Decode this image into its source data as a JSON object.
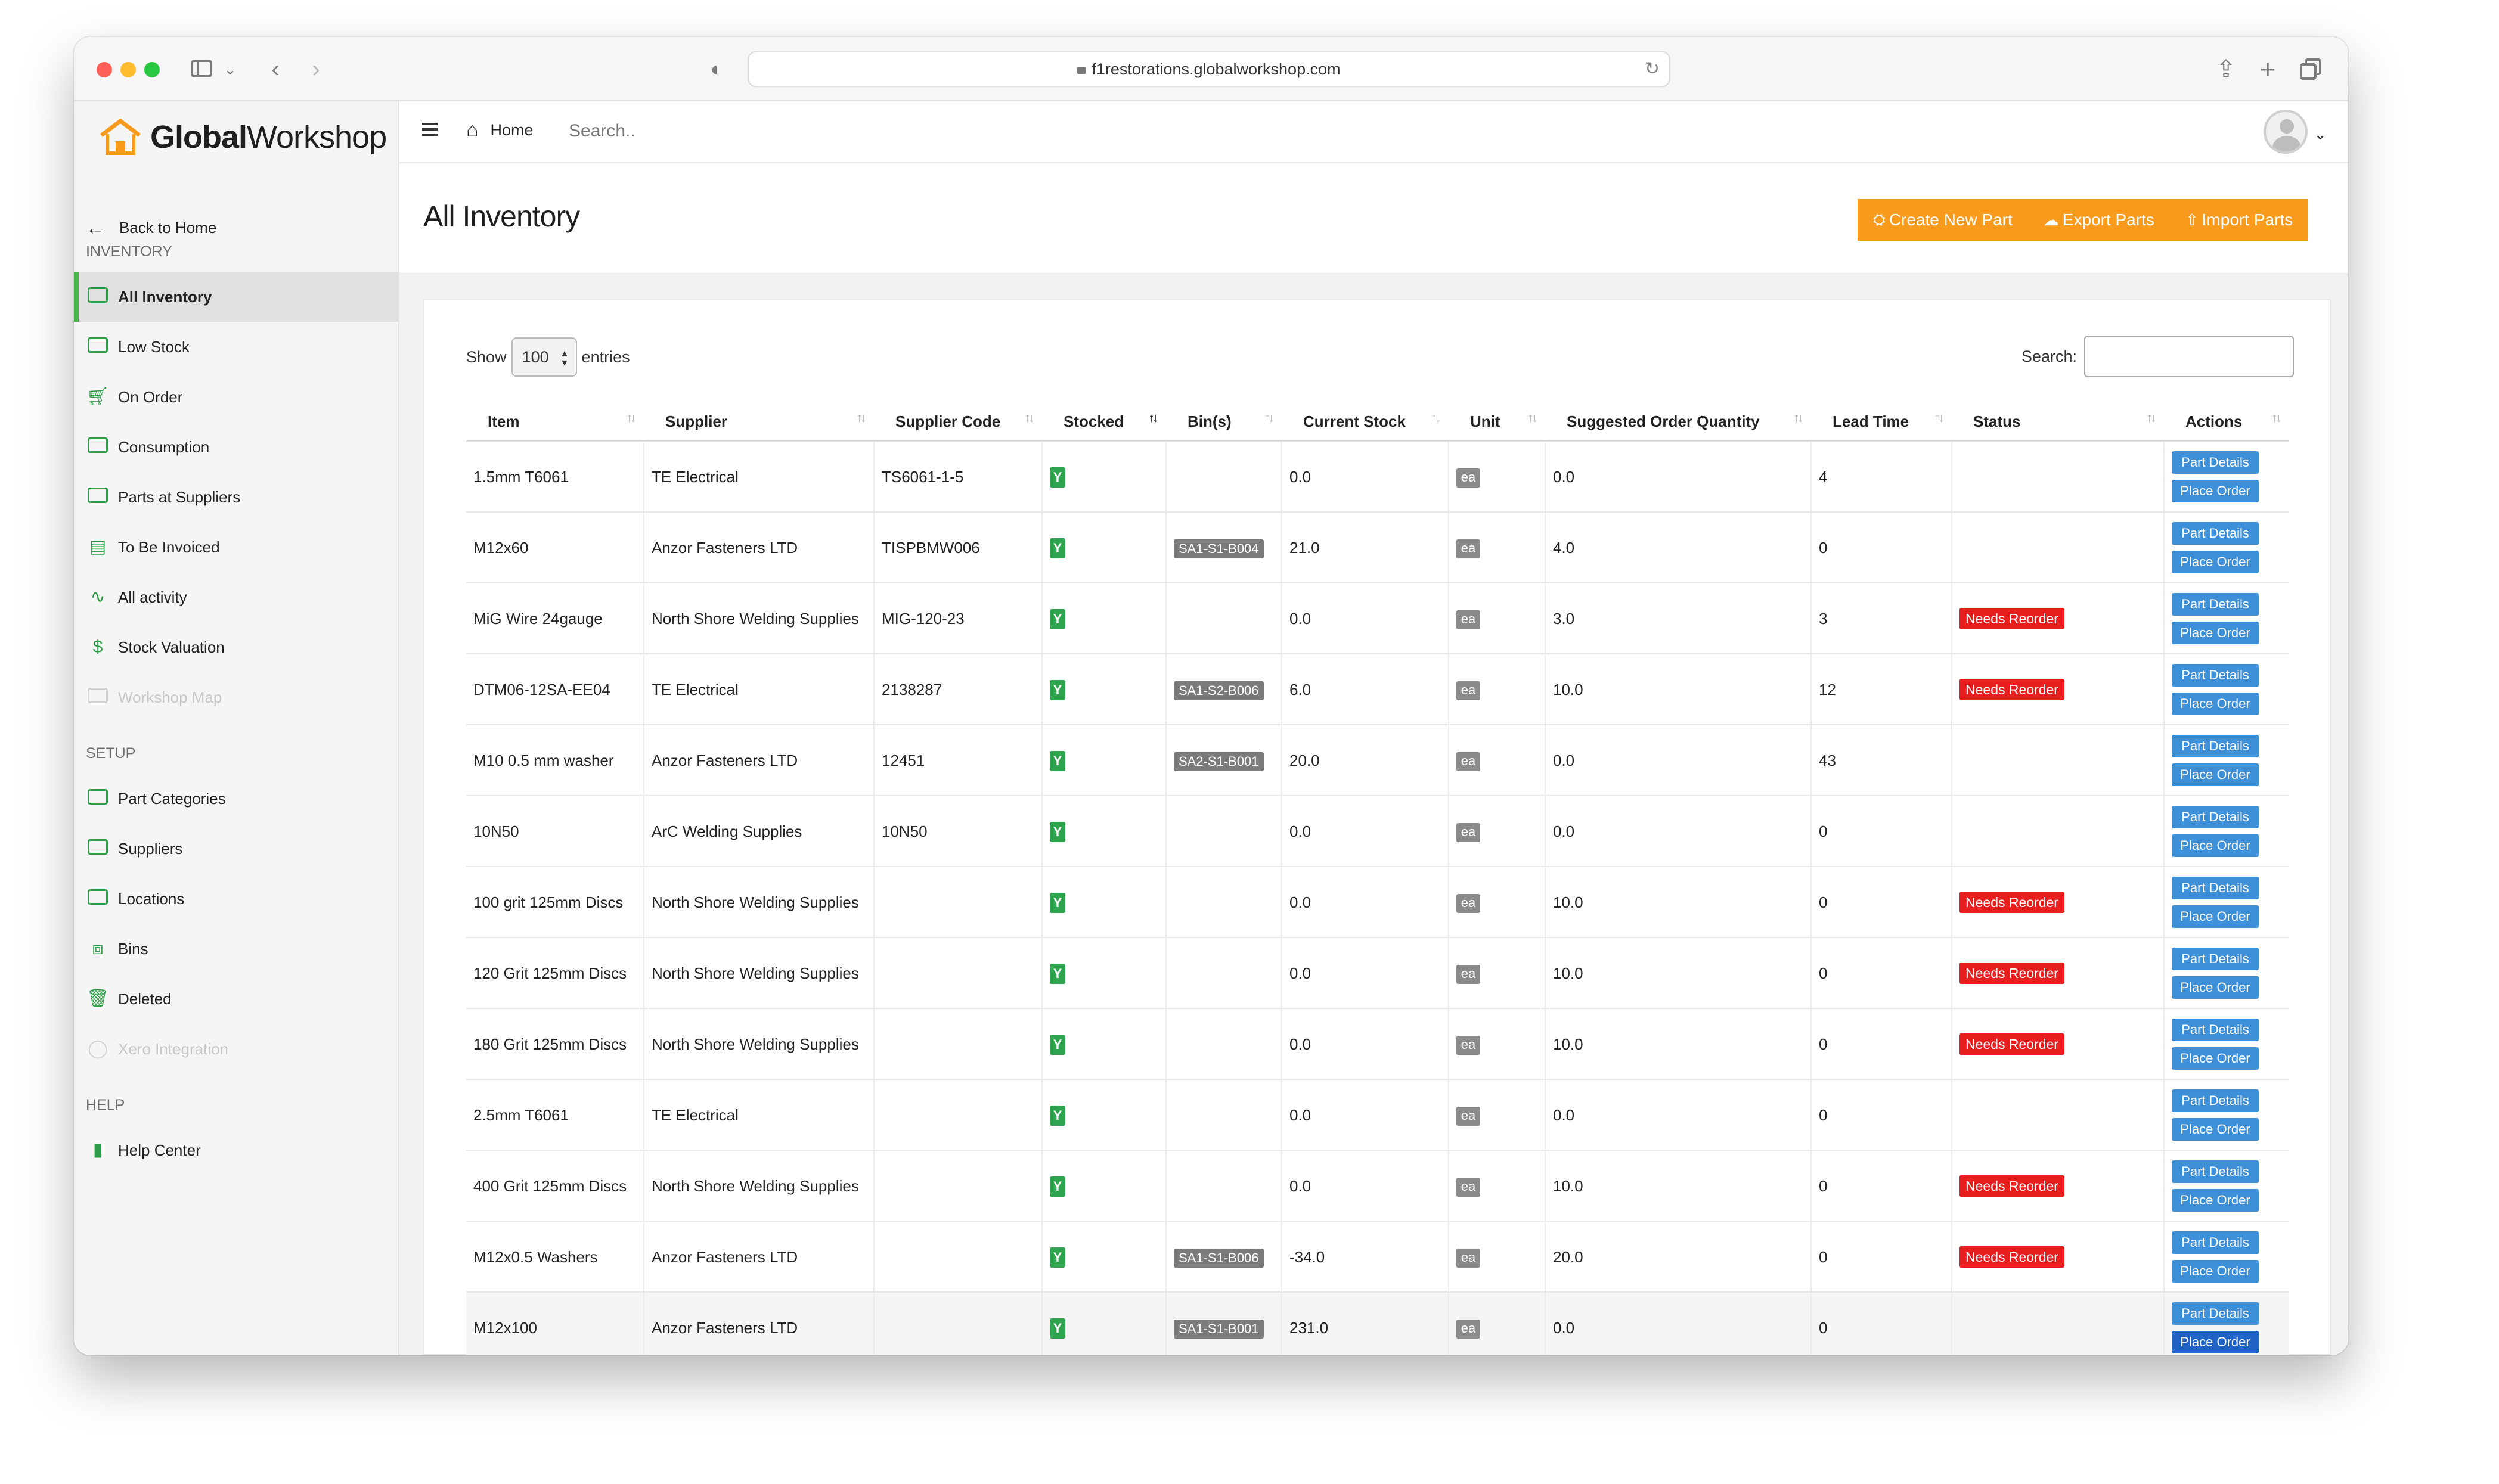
{
  "browser": {
    "url": "f1restorations.globalworkshop.com"
  },
  "brand": {
    "logo_bold": "Global",
    "logo_light": "Workshop",
    "brand_color": "#f89a1b"
  },
  "sidebar": {
    "back_label": "Back to Home",
    "inventory_label": "INVENTORY",
    "inventory_items": [
      {
        "label": "All Inventory",
        "icon": "warehouse-icon"
      },
      {
        "label": "Low Stock",
        "icon": "low-stock-icon"
      },
      {
        "label": "On Order",
        "icon": "cart-icon"
      },
      {
        "label": "Consumption",
        "icon": "truck-icon"
      },
      {
        "label": "Parts at Suppliers",
        "icon": "supplier-truck-icon"
      },
      {
        "label": "To Be Invoiced",
        "icon": "invoice-icon"
      },
      {
        "label": "All activity",
        "icon": "activity-icon"
      },
      {
        "label": "Stock Valuation",
        "icon": "dollar-icon"
      },
      {
        "label": "Workshop Map",
        "icon": "map-icon"
      }
    ],
    "setup_label": "SETUP",
    "setup_items": [
      {
        "label": "Part Categories",
        "icon": "categories-icon"
      },
      {
        "label": "Suppliers",
        "icon": "supplier-truck-icon"
      },
      {
        "label": "Locations",
        "icon": "locations-icon"
      },
      {
        "label": "Bins",
        "icon": "bins-icon"
      },
      {
        "label": "Deleted",
        "icon": "trash-icon"
      },
      {
        "label": "Xero Integration",
        "icon": "xero-icon"
      }
    ],
    "help_label": "HELP",
    "help_items": [
      {
        "label": "Help Center",
        "icon": "book-icon"
      }
    ]
  },
  "topbar": {
    "home_label": "Home",
    "search_placeholder": "Search.."
  },
  "page": {
    "title": "All Inventory",
    "buttons": {
      "create": "Create New Part",
      "export": "Export Parts",
      "import": "Import Parts"
    }
  },
  "table_controls": {
    "show_label": "Show",
    "entries_value": "100",
    "entries_label": "entries",
    "search_label": "Search:"
  },
  "table": {
    "columns": [
      "Item",
      "Supplier",
      "Supplier Code",
      "Stocked",
      "Bin(s)",
      "Current Stock",
      "Unit",
      "Suggested Order Quantity",
      "Lead Time",
      "Status",
      "Actions"
    ],
    "action_labels": {
      "details": "Part Details",
      "order": "Place Order"
    },
    "rows": [
      {
        "item": "1.5mm T6061",
        "supplier": "TE Electrical",
        "code": "TS6061-1-5",
        "stocked": "Y",
        "bin": "",
        "current": "0.0",
        "unit": "ea",
        "suggested": "0.0",
        "lead": "4",
        "status": ""
      },
      {
        "item": "M12x60",
        "supplier": "Anzor Fasteners LTD",
        "code": "TISPBMW006",
        "stocked": "Y",
        "bin": "SA1-S1-B004",
        "current": "21.0",
        "unit": "ea",
        "suggested": "4.0",
        "lead": "0",
        "status": ""
      },
      {
        "item": "MiG Wire 24gauge",
        "supplier": "North Shore Welding Supplies",
        "code": "MIG-120-23",
        "stocked": "Y",
        "bin": "",
        "current": "0.0",
        "unit": "ea",
        "suggested": "3.0",
        "lead": "3",
        "status": "Needs Reorder"
      },
      {
        "item": "DTM06-12SA-EE04",
        "supplier": "TE Electrical",
        "code": "2138287",
        "stocked": "Y",
        "bin": "SA1-S2-B006",
        "current": "6.0",
        "unit": "ea",
        "suggested": "10.0",
        "lead": "12",
        "status": "Needs Reorder"
      },
      {
        "item": "M10 0.5 mm washer",
        "supplier": "Anzor Fasteners LTD",
        "code": "12451",
        "stocked": "Y",
        "bin": "SA2-S1-B001",
        "current": "20.0",
        "unit": "ea",
        "suggested": "0.0",
        "lead": "43",
        "status": ""
      },
      {
        "item": "10N50",
        "supplier": "ArC Welding Supplies",
        "code": "10N50",
        "stocked": "Y",
        "bin": "",
        "current": "0.0",
        "unit": "ea",
        "suggested": "0.0",
        "lead": "0",
        "status": ""
      },
      {
        "item": "100 grit 125mm Discs",
        "supplier": "North Shore Welding Supplies",
        "code": "",
        "stocked": "Y",
        "bin": "",
        "current": "0.0",
        "unit": "ea",
        "suggested": "10.0",
        "lead": "0",
        "status": "Needs Reorder"
      },
      {
        "item": "120 Grit 125mm Discs",
        "supplier": "North Shore Welding Supplies",
        "code": "",
        "stocked": "Y",
        "bin": "",
        "current": "0.0",
        "unit": "ea",
        "suggested": "10.0",
        "lead": "0",
        "status": "Needs Reorder"
      },
      {
        "item": "180 Grit 125mm Discs",
        "supplier": "North Shore Welding Supplies",
        "code": "",
        "stocked": "Y",
        "bin": "",
        "current": "0.0",
        "unit": "ea",
        "suggested": "10.0",
        "lead": "0",
        "status": "Needs Reorder"
      },
      {
        "item": "2.5mm T6061",
        "supplier": "TE Electrical",
        "code": "",
        "stocked": "Y",
        "bin": "",
        "current": "0.0",
        "unit": "ea",
        "suggested": "0.0",
        "lead": "0",
        "status": ""
      },
      {
        "item": "400 Grit 125mm Discs",
        "supplier": "North Shore Welding Supplies",
        "code": "",
        "stocked": "Y",
        "bin": "",
        "current": "0.0",
        "unit": "ea",
        "suggested": "10.0",
        "lead": "0",
        "status": "Needs Reorder"
      },
      {
        "item": "M12x0.5 Washers",
        "supplier": "Anzor Fasteners LTD",
        "code": "",
        "stocked": "Y",
        "bin": "SA1-S1-B006",
        "current": "-34.0",
        "unit": "ea",
        "suggested": "20.0",
        "lead": "0",
        "status": "Needs Reorder"
      },
      {
        "item": "M12x100",
        "supplier": "Anzor Fasteners LTD",
        "code": "",
        "stocked": "Y",
        "bin": "SA1-S1-B001",
        "current": "231.0",
        "unit": "ea",
        "suggested": "0.0",
        "lead": "0",
        "status": ""
      }
    ]
  }
}
